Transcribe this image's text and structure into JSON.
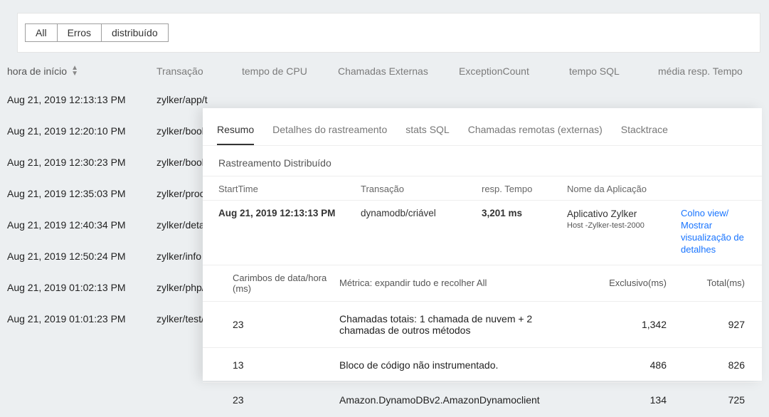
{
  "filters": {
    "all": "All",
    "errors": "Erros",
    "distributed": "distribuído"
  },
  "columns": {
    "start": "hora de início",
    "transaction": "Transação",
    "cpu": "tempo de CPU",
    "external": "Chamadas Externas",
    "exception": "ExceptionCount",
    "sql": "tempo SQL",
    "avg": "média resp. Tempo"
  },
  "rows": [
    {
      "time": "Aug 21, 2019 12:13:13 PM",
      "txn": "zylker/app/t"
    },
    {
      "time": "Aug 21, 2019 12:20:10 PM",
      "txn": "zylker/book"
    },
    {
      "time": "Aug 21, 2019 12:30:23 PM",
      "txn": "zylker/book"
    },
    {
      "time": "Aug 21, 2019 12:35:03 PM",
      "txn": "zylker/proce"
    },
    {
      "time": "Aug 21, 2019 12:40:34 PM",
      "txn": "zylker/detai"
    },
    {
      "time": "Aug 21, 2019 12:50:24 PM",
      "txn": "zylker/info"
    },
    {
      "time": "Aug 21, 2019 01:02:13 PM",
      "txn": "zylker/php/r"
    },
    {
      "time": "Aug 21, 2019 01:01:23 PM",
      "txn": "zylker/test/p"
    }
  ],
  "detail": {
    "tabs": {
      "summary": "Resumo",
      "trace": "Detalhes do rastreamento",
      "sql": "stats SQL",
      "remote": "Chamadas remotas (externas)",
      "stack": "Stacktrace"
    },
    "section": "Rastreamento Distribuído",
    "meta_head": {
      "start": "StartTime",
      "txn": "Transação",
      "resp": "resp. Tempo",
      "app": "Nome da Aplicação"
    },
    "meta": {
      "start": "Aug 21, 2019 12:13:13 PM",
      "txn": "dynamodb/criável",
      "resp": "3,201 ms",
      "app": "Aplicativo Zylker",
      "host": "Host -Zylker-test-2000",
      "link1": "Colno view/",
      "link2": "Mostrar visualização de detalhes"
    },
    "inner_head": {
      "ts": "Carimbos de data/hora (ms)",
      "metric": "Métrica: expandir tudo e recolher All",
      "excl": "Exclusivo(ms)",
      "total": "Total(ms)"
    },
    "inner_rows": [
      {
        "ts": "23",
        "metric": "Chamadas totais: 1 chamada de nuvem + 2 chamadas de outros métodos",
        "excl": "1,342",
        "total": "927"
      },
      {
        "ts": "13",
        "metric": "Bloco de código não instrumentado.",
        "excl": "486",
        "total": "826"
      },
      {
        "ts": "23",
        "metric": "Amazon.DynamoDBv2.AmazonDynamoclient",
        "excl": "134",
        "total": "725"
      }
    ]
  }
}
